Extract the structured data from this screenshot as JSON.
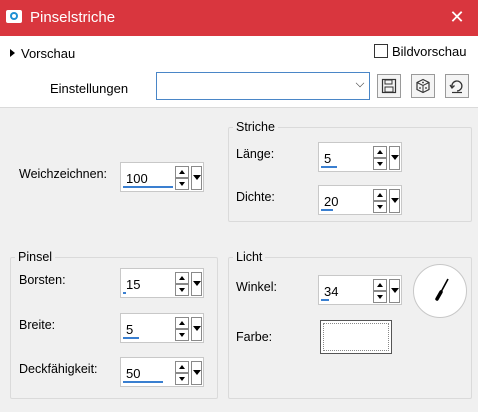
{
  "window": {
    "title": "Pinselstriche",
    "close_glyph": "✕",
    "accent": "#d9363e"
  },
  "preview": {
    "vorschau_label": "Vorschau",
    "bildvorschau_label": "Bildvorschau",
    "bildvorschau_checked": false
  },
  "presets": {
    "label": "Einstellungen",
    "value": "",
    "buttons": [
      {
        "name": "save-preset-button",
        "icon": "floppy-disk-icon"
      },
      {
        "name": "random-button",
        "icon": "dice-icon"
      },
      {
        "name": "reset-button",
        "icon": "reset-icon"
      }
    ]
  },
  "weichzeichnen": {
    "label": "Weichzeichnen:",
    "value": "100"
  },
  "striche": {
    "title": "Striche",
    "laenge": {
      "label": "Länge:",
      "value": "5"
    },
    "dichte": {
      "label": "Dichte:",
      "value": "20"
    }
  },
  "pinsel": {
    "title": "Pinsel",
    "borsten": {
      "label": "Borsten:",
      "value": "15"
    },
    "breite": {
      "label": "Breite:",
      "value": "5"
    },
    "deckfaehigkeit": {
      "label": "Deckfähigkeit:",
      "value": "50"
    }
  },
  "licht": {
    "title": "Licht",
    "winkel": {
      "label": "Winkel:",
      "value": "34"
    },
    "farbe": {
      "label": "Farbe:",
      "color": "#ffffff"
    }
  }
}
